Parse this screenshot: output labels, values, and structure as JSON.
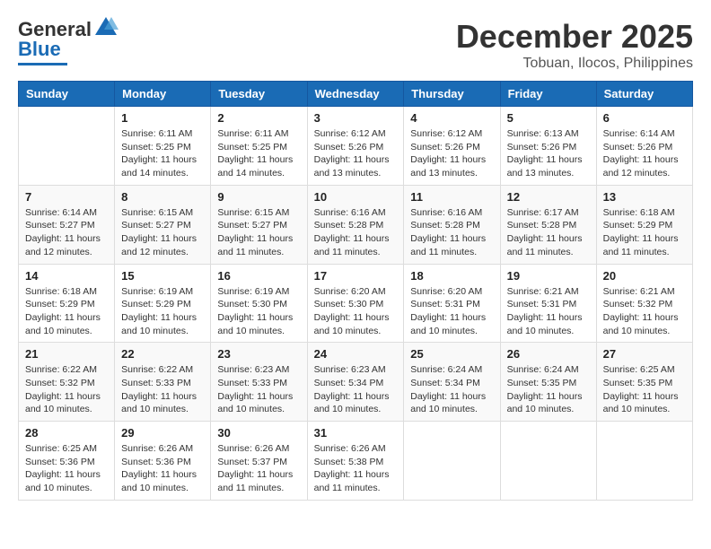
{
  "header": {
    "logo_line1": "General",
    "logo_line2": "Blue",
    "month": "December 2025",
    "location": "Tobuan, Ilocos, Philippines"
  },
  "weekdays": [
    "Sunday",
    "Monday",
    "Tuesday",
    "Wednesday",
    "Thursday",
    "Friday",
    "Saturday"
  ],
  "weeks": [
    [
      {
        "day": "",
        "info": ""
      },
      {
        "day": "1",
        "info": "Sunrise: 6:11 AM\nSunset: 5:25 PM\nDaylight: 11 hours\nand 14 minutes."
      },
      {
        "day": "2",
        "info": "Sunrise: 6:11 AM\nSunset: 5:25 PM\nDaylight: 11 hours\nand 14 minutes."
      },
      {
        "day": "3",
        "info": "Sunrise: 6:12 AM\nSunset: 5:26 PM\nDaylight: 11 hours\nand 13 minutes."
      },
      {
        "day": "4",
        "info": "Sunrise: 6:12 AM\nSunset: 5:26 PM\nDaylight: 11 hours\nand 13 minutes."
      },
      {
        "day": "5",
        "info": "Sunrise: 6:13 AM\nSunset: 5:26 PM\nDaylight: 11 hours\nand 13 minutes."
      },
      {
        "day": "6",
        "info": "Sunrise: 6:14 AM\nSunset: 5:26 PM\nDaylight: 11 hours\nand 12 minutes."
      }
    ],
    [
      {
        "day": "7",
        "info": "Sunrise: 6:14 AM\nSunset: 5:27 PM\nDaylight: 11 hours\nand 12 minutes."
      },
      {
        "day": "8",
        "info": "Sunrise: 6:15 AM\nSunset: 5:27 PM\nDaylight: 11 hours\nand 12 minutes."
      },
      {
        "day": "9",
        "info": "Sunrise: 6:15 AM\nSunset: 5:27 PM\nDaylight: 11 hours\nand 11 minutes."
      },
      {
        "day": "10",
        "info": "Sunrise: 6:16 AM\nSunset: 5:28 PM\nDaylight: 11 hours\nand 11 minutes."
      },
      {
        "day": "11",
        "info": "Sunrise: 6:16 AM\nSunset: 5:28 PM\nDaylight: 11 hours\nand 11 minutes."
      },
      {
        "day": "12",
        "info": "Sunrise: 6:17 AM\nSunset: 5:28 PM\nDaylight: 11 hours\nand 11 minutes."
      },
      {
        "day": "13",
        "info": "Sunrise: 6:18 AM\nSunset: 5:29 PM\nDaylight: 11 hours\nand 11 minutes."
      }
    ],
    [
      {
        "day": "14",
        "info": "Sunrise: 6:18 AM\nSunset: 5:29 PM\nDaylight: 11 hours\nand 10 minutes."
      },
      {
        "day": "15",
        "info": "Sunrise: 6:19 AM\nSunset: 5:29 PM\nDaylight: 11 hours\nand 10 minutes."
      },
      {
        "day": "16",
        "info": "Sunrise: 6:19 AM\nSunset: 5:30 PM\nDaylight: 11 hours\nand 10 minutes."
      },
      {
        "day": "17",
        "info": "Sunrise: 6:20 AM\nSunset: 5:30 PM\nDaylight: 11 hours\nand 10 minutes."
      },
      {
        "day": "18",
        "info": "Sunrise: 6:20 AM\nSunset: 5:31 PM\nDaylight: 11 hours\nand 10 minutes."
      },
      {
        "day": "19",
        "info": "Sunrise: 6:21 AM\nSunset: 5:31 PM\nDaylight: 11 hours\nand 10 minutes."
      },
      {
        "day": "20",
        "info": "Sunrise: 6:21 AM\nSunset: 5:32 PM\nDaylight: 11 hours\nand 10 minutes."
      }
    ],
    [
      {
        "day": "21",
        "info": "Sunrise: 6:22 AM\nSunset: 5:32 PM\nDaylight: 11 hours\nand 10 minutes."
      },
      {
        "day": "22",
        "info": "Sunrise: 6:22 AM\nSunset: 5:33 PM\nDaylight: 11 hours\nand 10 minutes."
      },
      {
        "day": "23",
        "info": "Sunrise: 6:23 AM\nSunset: 5:33 PM\nDaylight: 11 hours\nand 10 minutes."
      },
      {
        "day": "24",
        "info": "Sunrise: 6:23 AM\nSunset: 5:34 PM\nDaylight: 11 hours\nand 10 minutes."
      },
      {
        "day": "25",
        "info": "Sunrise: 6:24 AM\nSunset: 5:34 PM\nDaylight: 11 hours\nand 10 minutes."
      },
      {
        "day": "26",
        "info": "Sunrise: 6:24 AM\nSunset: 5:35 PM\nDaylight: 11 hours\nand 10 minutes."
      },
      {
        "day": "27",
        "info": "Sunrise: 6:25 AM\nSunset: 5:35 PM\nDaylight: 11 hours\nand 10 minutes."
      }
    ],
    [
      {
        "day": "28",
        "info": "Sunrise: 6:25 AM\nSunset: 5:36 PM\nDaylight: 11 hours\nand 10 minutes."
      },
      {
        "day": "29",
        "info": "Sunrise: 6:26 AM\nSunset: 5:36 PM\nDaylight: 11 hours\nand 10 minutes."
      },
      {
        "day": "30",
        "info": "Sunrise: 6:26 AM\nSunset: 5:37 PM\nDaylight: 11 hours\nand 11 minutes."
      },
      {
        "day": "31",
        "info": "Sunrise: 6:26 AM\nSunset: 5:38 PM\nDaylight: 11 hours\nand 11 minutes."
      },
      {
        "day": "",
        "info": ""
      },
      {
        "day": "",
        "info": ""
      },
      {
        "day": "",
        "info": ""
      }
    ]
  ]
}
